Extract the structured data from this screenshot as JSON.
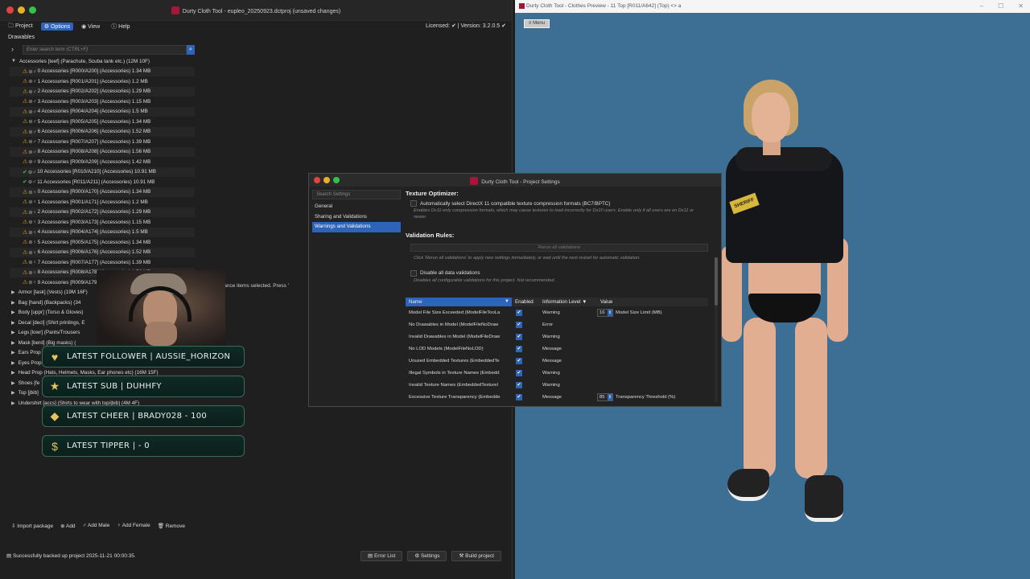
{
  "app": {
    "title": "Durty Cloth Tool - eupleo_20250923.dctproj (unsaved changes)",
    "menu": [
      "Project",
      "Options",
      "View",
      "Help"
    ],
    "license_text": "Licensed: ✔ | Version: 3.2.0.5 ✔",
    "section_label": "Drawables",
    "search_placeholder": "Enter search term (CTRL+F)",
    "tree_root": "Accessories [teef] (Parachute, Scuba tank etc.) (12M 10F)",
    "accessories": [
      "0 Accessories [R000/A200] (Accessories) 1.34 MB",
      "1 Accessories [R001/A201] (Accessories) 1.2 MB",
      "2 Accessories [R002/A202] (Accessories) 1.29 MB",
      "3 Accessories [R003/A203] (Accessories) 1.15 MB",
      "4 Accessories [R004/A204] (Accessories) 1.5 MB",
      "5 Accessories [R005/A205] (Accessories) 1.34 MB",
      "6 Accessories [R006/A206] (Accessories) 1.52 MB",
      "7 Accessories [R007/A207] (Accessories) 1.39 MB",
      "8 Accessories [R008/A208] (Accessories) 1.56 MB",
      "9 Accessories [R009/A209] (Accessories) 1.42 MB",
      "10 Accessories [R010/A210] (Accessories) 10.91 MB",
      "11 Accessories [R011/A211] (Accessories) 10.91 MB",
      "0 Accessories [R000/A170] (Accessories) 1.34 MB",
      "1 Accessories [R001/A171] (Accessories) 1.2 MB",
      "2 Accessories [R002/A172] (Accessories) 1.29 MB",
      "3 Accessories [R003/A173] (Accessories) 1.15 MB",
      "4 Accessories [R004/A174] (Accessories) 1.5 MB",
      "5 Accessories [R005/A175] (Accessories) 1.34 MB",
      "6 Accessories [R006/A176] (Accessories) 1.52 MB",
      "7 Accessories [R007/A177] (Accessories) 1.39 MB",
      "8 Accessories [R008/A178] (Accessories) 1.56 MB",
      "9 Accessories [R009/A179] (Accessories) 1.42 MB"
    ],
    "groups": [
      "Armor [task] (Vests) (19M 16F)",
      "Bag [hand] (Backpacks) (34",
      "Body [uppr] (Torso & Gloves)",
      "Decal [decl] (Shirt printings, E",
      "Legs [lowr] (Pants/Trousers",
      "Mask [berd] (Big masks) (",
      "Ears Prop",
      "Eyes Prop",
      "Head Prop (Hats, Helmets, Masks, Ear phones etc) (16M 15F)",
      "Shoes [fe",
      "Top [jbib]",
      "Undershirt [accs] (Shirts to wear with top/jbib) (4M 4F)"
    ],
    "status_message": "appearance items selected. Press '",
    "bottom_actions": [
      "Import package",
      "Add",
      "Add Male",
      "Add Female",
      "Remove"
    ],
    "statusbar": "Successfully backed up project 2025-11-21 00:00:35.",
    "footer_buttons": [
      "Error List",
      "Settings",
      "Build project"
    ]
  },
  "overlay": [
    {
      "icon": "heart-icon",
      "text": "LATEST FOLLOWER | AUSSIE_HORIZON"
    },
    {
      "icon": "star-icon",
      "text": "LATEST SUB | DUHHFY"
    },
    {
      "icon": "diamond-icon",
      "text": "LATEST CHEER | BRADY028 - 100"
    },
    {
      "icon": "dollar-icon",
      "text": "LATEST TIPPER | - 0"
    }
  ],
  "preview": {
    "title": "Durty Cloth Tool - Clothes Preview - 11 Top [R011/A642] (Top) <> a",
    "menu_button": "≡ Menu",
    "badge_text": "SHERIFF"
  },
  "dialog": {
    "title": "Durty Cloth Tool - Project Settings",
    "search_placeholder": "Search Settings",
    "nav": [
      "General",
      "Sharing and Validations",
      "Warnings and Validations"
    ],
    "texture_optimizer": {
      "heading": "Texture Optimizer:",
      "checkbox_label": "Automatically select DirectX 11 compatible texture compression formats (BC7/BPTC)",
      "hint": "Enables Dx11-only compression formats, which may cause textures to load incorrectly for Dx10 users. Enable only if all users are on Dx11 or newer."
    },
    "validation": {
      "heading": "Validation Rules:",
      "rerun_label": "Rerun all validations",
      "rerun_hint": "Click 'Rerun all validations' to apply new settings immediately, or wait until the next restart for automatic validation.",
      "disable_label": "Disable all data validations",
      "disable_hint": "Disables all configurable validations for this project. Not recommended."
    },
    "table": {
      "headers": [
        "Name",
        "Enabled",
        "Information Level",
        "Value"
      ],
      "rows": [
        {
          "name": "Model File Size Exceeded (ModelFileTooLa",
          "level": "Warning",
          "value": "16",
          "value_label": "Model Size Limit (MB)"
        },
        {
          "name": "No Drawables in Model (ModelFileNoDraw",
          "level": "Error",
          "value": "",
          "value_label": ""
        },
        {
          "name": "Invalid Drawables in Model (ModelFileDraw",
          "level": "Warning",
          "value": "",
          "value_label": ""
        },
        {
          "name": "No LOD Models (ModelFileNoLOD)",
          "level": "Message",
          "value": "",
          "value_label": ""
        },
        {
          "name": "Unused Embedded Textures (EmbeddedTe",
          "level": "Message",
          "value": "",
          "value_label": ""
        },
        {
          "name": "Illegal Symbols in Texture Names (Embedd",
          "level": "Warning",
          "value": "",
          "value_label": ""
        },
        {
          "name": "Invalid Texture Names (EmbeddedTexturel",
          "level": "Warning",
          "value": "",
          "value_label": ""
        },
        {
          "name": "Excessive Texture Transparency (Embedde",
          "level": "Message",
          "value": "85",
          "value_label": "Transparency Threshold (%)"
        }
      ]
    }
  }
}
